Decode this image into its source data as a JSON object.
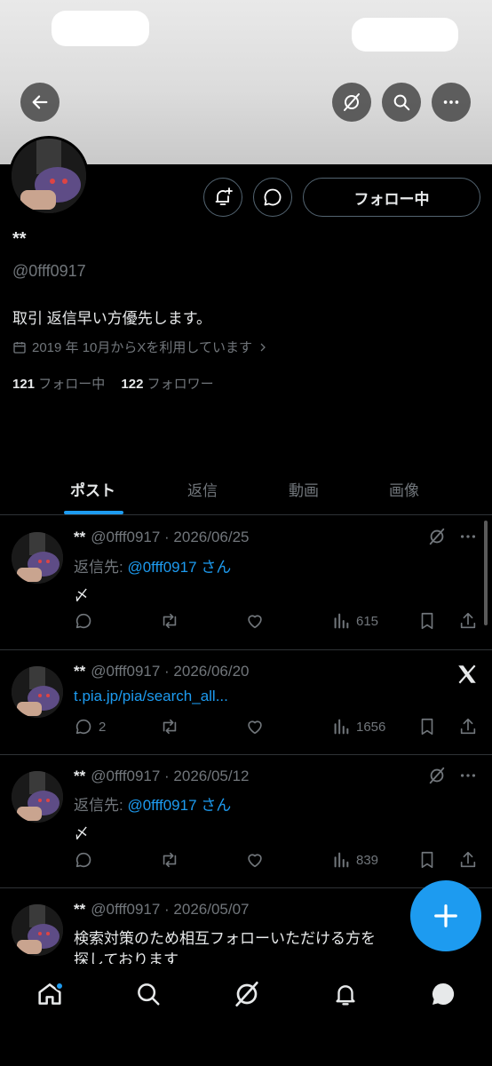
{
  "profile": {
    "name": "**",
    "handle": "@0fff0917",
    "bio": "取引 返信早い方優先します。",
    "joined": "2019 年 10月からXを利用しています",
    "following_count": "121",
    "following_label": "フォロー中",
    "followers_count": "122",
    "followers_label": "フォロワー",
    "follow_button": "フォロー中"
  },
  "tabs": [
    "ポスト",
    "返信",
    "動画",
    "画像"
  ],
  "active_tab": "ポスト",
  "posts": [
    {
      "name": "**",
      "meta": "@0fff0917 · 2026/06/25",
      "reply_prefix": "返信先: ",
      "reply_to": "@0fff0917 さん",
      "text": "〆",
      "views": "615"
    },
    {
      "name": "**",
      "meta": "@0fff0917 · 2026/06/20",
      "link": "t.pia.jp/pia/search_all...",
      "replies": "2",
      "views": "1656"
    },
    {
      "name": "**",
      "meta": "@0fff0917 · 2026/05/12",
      "reply_prefix": "返信先: ",
      "reply_to": "@0fff0917 さん",
      "text": "〆",
      "views": "839"
    },
    {
      "name": "**",
      "meta": "@0fff0917 · 2026/05/07",
      "text_line1": "検索対策のため相互フォローいただける方を",
      "text_line2": "探しております"
    }
  ],
  "colors": {
    "accent": "#1d9bf0",
    "background": "#000000",
    "muted": "#71767b"
  },
  "icons": [
    "back-arrow-icon",
    "grok-icon",
    "search-icon",
    "more-icon",
    "bell-plus-icon",
    "message-icon",
    "calendar-icon",
    "chevron-right-icon",
    "reply-icon",
    "repost-icon",
    "like-icon",
    "views-icon",
    "bookmark-icon",
    "share-icon",
    "x-logo-icon",
    "compose-plus-icon",
    "home-icon",
    "notifications-icon",
    "messages-icon"
  ]
}
